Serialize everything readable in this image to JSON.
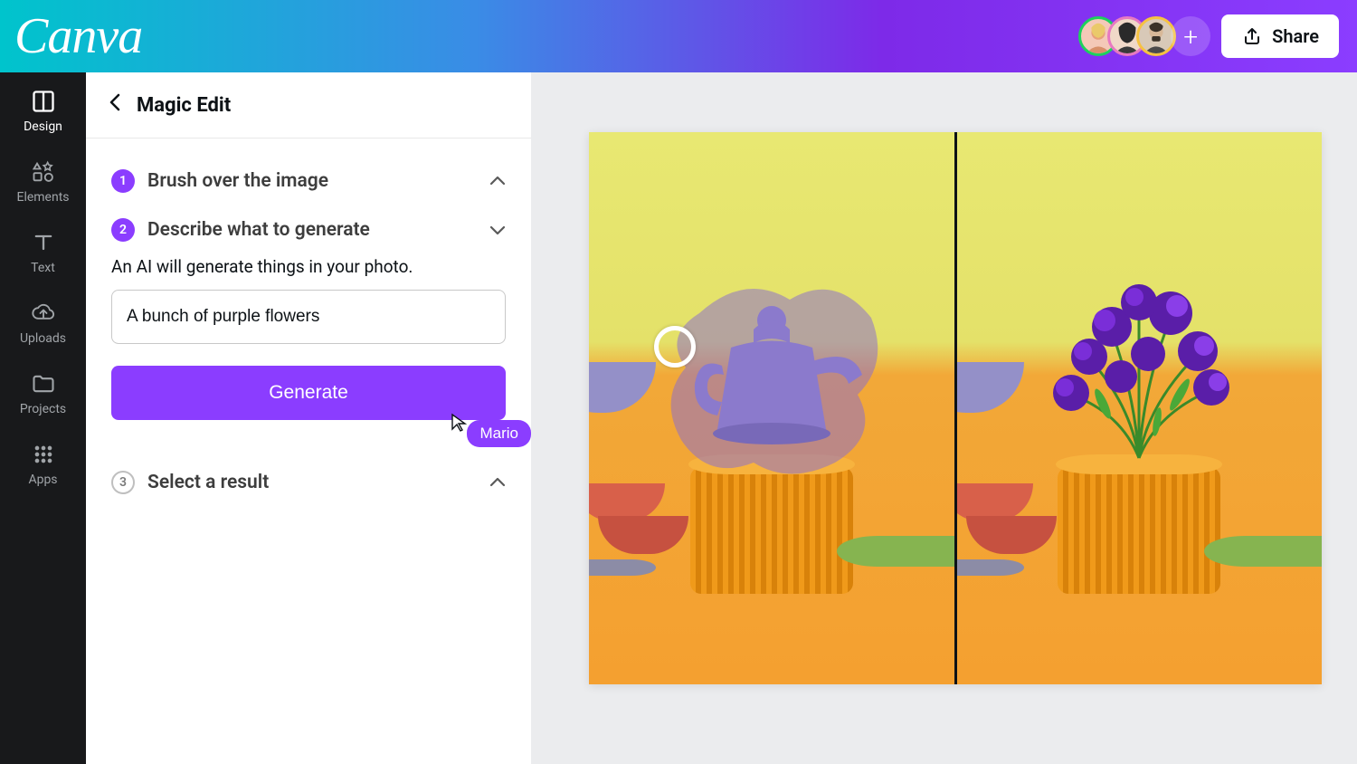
{
  "header": {
    "logo_text": "Canva",
    "share_label": "Share"
  },
  "nav": {
    "items": [
      {
        "label": "Design"
      },
      {
        "label": "Elements"
      },
      {
        "label": "Text"
      },
      {
        "label": "Uploads"
      },
      {
        "label": "Projects"
      },
      {
        "label": "Apps"
      }
    ]
  },
  "panel": {
    "title": "Magic Edit",
    "steps": {
      "s1": {
        "num": "1",
        "title": "Brush over the image"
      },
      "s2": {
        "num": "2",
        "title": "Describe what to generate",
        "desc": "An AI will generate things in your photo."
      },
      "s3": {
        "num": "3",
        "title": "Select a result"
      }
    },
    "prompt_value": "A bunch of purple flowers",
    "generate_label": "Generate",
    "cursor_user": "Mario"
  }
}
